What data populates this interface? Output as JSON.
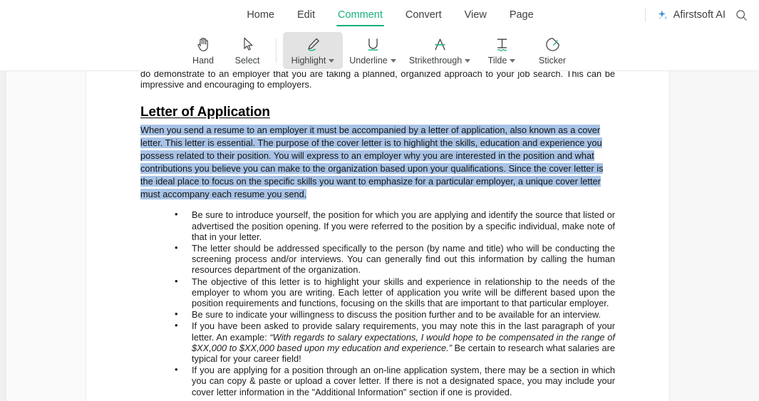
{
  "menu": {
    "tabs": [
      {
        "label": "Home",
        "active": false
      },
      {
        "label": "Edit",
        "active": false
      },
      {
        "label": "Comment",
        "active": true
      },
      {
        "label": "Convert",
        "active": false
      },
      {
        "label": "View",
        "active": false
      },
      {
        "label": "Page",
        "active": false
      }
    ],
    "ai_label": "Afirstsoft AI",
    "ai_icon": "sparkle-icon",
    "search_icon": "search-icon",
    "accent_color": "#14b07d",
    "ai_icon_color": "#3a8fd9"
  },
  "toolbar": {
    "items": [
      {
        "label": "Hand",
        "icon": "hand-icon",
        "caret": false,
        "active": false
      },
      {
        "label": "Select",
        "icon": "cursor-arrow-icon",
        "caret": false,
        "active": false
      },
      {
        "label": "Highlight",
        "icon": "highlight-pen-icon",
        "caret": true,
        "active": true
      },
      {
        "label": "Underline",
        "icon": "underline-icon",
        "caret": true,
        "active": false
      },
      {
        "label": "Strikethrough",
        "icon": "strikethrough-icon",
        "caret": true,
        "active": false
      },
      {
        "label": "Tilde",
        "icon": "tilde-text-icon",
        "caret": true,
        "active": false
      },
      {
        "label": "Sticker",
        "icon": "sticker-icon",
        "caret": false,
        "active": false
      }
    ],
    "active_bg": "#e3e3e3",
    "icon_accent": "#14b07d"
  },
  "document": {
    "highlight_color": "#a8c3e6",
    "paragraph_cut": "do demonstrate to an employer that you are taking a planned, organized approach to your job search.  This can be impressive and encouraging to employers.",
    "heading": "Letter of Application",
    "highlighted_paragraph": "When you send a resume to an employer it must be accompanied by a letter of application, also known as a cover letter.  This letter is essential.  The purpose of the cover letter is to highlight the skills, education and experience you possess related to their position.  You will express to an employer why you are interested in the position and what contributions you believe you can make to the organization based upon your qualifications. Since the cover letter is the ideal place to focus on the specific skills you want to emphasize for a particular employer, a unique cover letter must accompany each resume you send.",
    "bullets": [
      {
        "text_before": "Be sure to introduce yourself, the position for which you are applying and identify the source that listed or advertised the position opening.  If you were referred to the position by a specific individual, make note of that in your letter.",
        "italic": "",
        "text_after": ""
      },
      {
        "text_before": "The letter should be addressed specifically to the person (by name and title) who will be conducting the screening process and/or interviews.  You can generally find out this information by calling the human resources department of the organization.",
        "italic": "",
        "text_after": ""
      },
      {
        "text_before": "The objective of this letter is to highlight your skills and experience in relationship to the needs of the employer to whom you are writing.  Each letter of application you write will be different based upon the position requirements and functions, focusing on the skills that are important to that particular employer.",
        "italic": "",
        "text_after": ""
      },
      {
        "text_before": "Be sure to indicate your willingness to discuss the position further and to be available for an interview.",
        "italic": "",
        "text_after": ""
      },
      {
        "text_before": "If you have been asked to provide salary requirements, you may note this in the last paragraph of your letter.  An example: ",
        "italic": "“With regards to salary expectations, I would hope to be compensated in the range of $XX,000 to $XX,000 based upon my education and experience.”",
        "text_after": "  Be certain to research what salaries are typical for your career field!"
      },
      {
        "text_before": "If you are applying for a position through an on-line application system, there may be a section in which you can copy & paste or upload a cover letter.  If there is not a designated space, you may include your cover letter information in the \"Additional Information\" section if one is provided.",
        "italic": "",
        "text_after": ""
      }
    ]
  }
}
